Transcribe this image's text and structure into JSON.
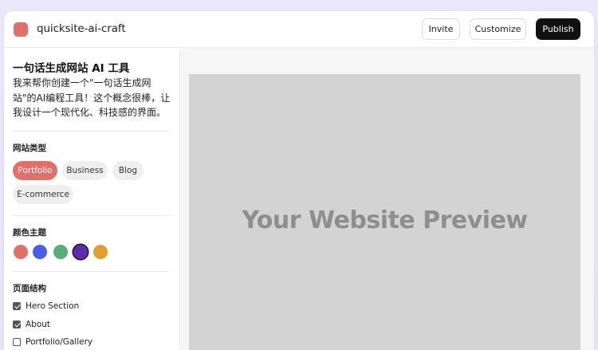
{
  "header": {
    "app_name": "quicksite-ai-craft",
    "invite_label": "Invite",
    "customize_label": "Customize",
    "publish_label": "Publish"
  },
  "colors": {
    "accent": "#e0706a",
    "publish_bg": "#111111",
    "preview_bg": "#d3d3d3"
  },
  "sidebar": {
    "title": "一句话生成网站 AI 工具",
    "description": "我来帮你创建一个\"一句话生成网站\"的AI编程工具！这个概念很棒，让我设计一个现代化、科技感的界面。",
    "site_type": {
      "label": "网站类型",
      "options": [
        "Portfolio",
        "Business",
        "Blog",
        "E-commerce"
      ],
      "selected": "Portfolio"
    },
    "color_theme": {
      "label": "颜色主题",
      "swatches": [
        "#e0706a",
        "#4a5de6",
        "#5aad7a",
        "#5b2bb0",
        "#e0a030"
      ],
      "selected_index": 3
    },
    "page_structure": {
      "label": "页面结构",
      "items": [
        {
          "label": "Hero Section",
          "checked": true
        },
        {
          "label": "About",
          "checked": true
        },
        {
          "label": "Portfolio/Gallery",
          "checked": false
        }
      ]
    }
  },
  "preview": {
    "placeholder": "Your Website Preview"
  }
}
